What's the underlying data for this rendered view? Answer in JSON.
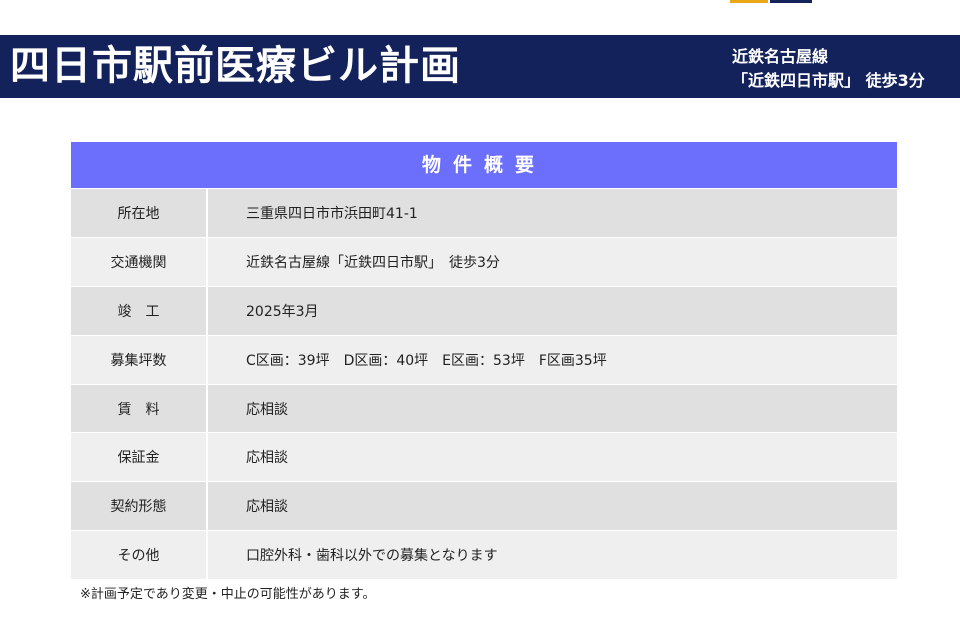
{
  "header": {
    "title": "四日市駅前医療ビル計画",
    "access_line1": "近鉄名古屋線",
    "access_line2": "「近鉄四日市駅」 徒歩3分"
  },
  "table": {
    "heading": "物件概要",
    "rows": [
      {
        "label": "所在地",
        "value": "三重県四日市市浜田町41-1"
      },
      {
        "label": "交通機関",
        "value": "近鉄名古屋線「近鉄四日市駅」　徒歩3分"
      },
      {
        "label": "竣　工",
        "value": "2025年3月"
      },
      {
        "label": "募集坪数",
        "value": "C区画：39坪　D区画：40坪　E区画：53坪　F区画35坪"
      },
      {
        "label": "賃　料",
        "value": "応相談"
      },
      {
        "label": "保証金",
        "value": "応相談"
      },
      {
        "label": "契約形態",
        "value": "応相談"
      },
      {
        "label": "その他",
        "value": "口腔外科・歯科以外での募集となります"
      }
    ]
  },
  "footnote": "※計画予定であり変更・中止の可能性があります。",
  "colors": {
    "navy": "#13225a",
    "table_header": "#6b6ffc",
    "accent_gold": "#e8a817"
  }
}
